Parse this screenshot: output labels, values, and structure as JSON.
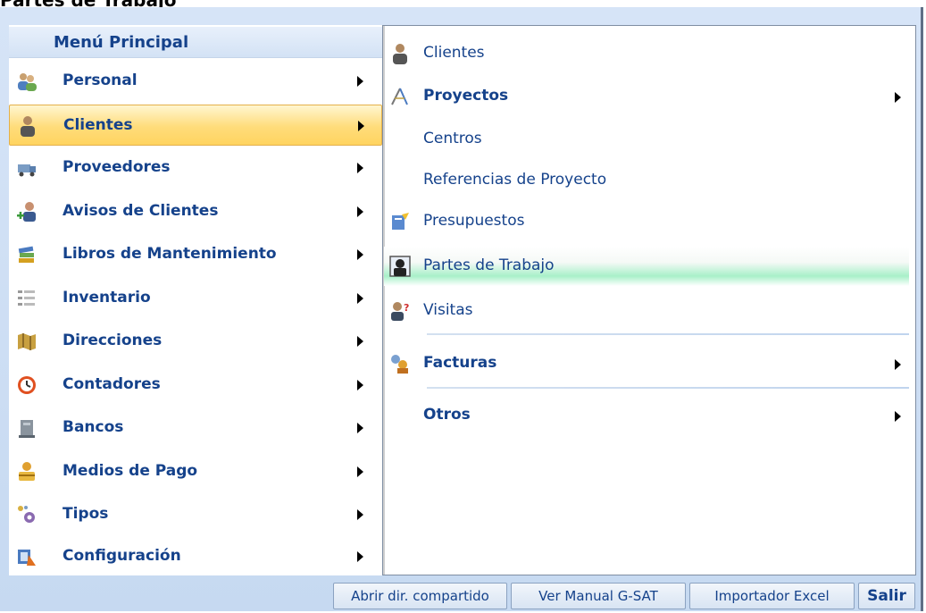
{
  "window": {
    "partial_title": "Partes de Trabajo"
  },
  "main_menu": {
    "header": "Menú Principal",
    "items": [
      {
        "label": "Personal",
        "icon": "people-icon"
      },
      {
        "label": "Clientes",
        "icon": "client-icon",
        "selected": true
      },
      {
        "label": "Proveedores",
        "icon": "truck-icon"
      },
      {
        "label": "Avisos de Clientes",
        "icon": "add-person-icon"
      },
      {
        "label": "Libros de Mantenimiento",
        "icon": "books-icon"
      },
      {
        "label": "Inventario",
        "icon": "list-icon"
      },
      {
        "label": "Direcciones",
        "icon": "map-icon"
      },
      {
        "label": "Contadores",
        "icon": "clock-icon"
      },
      {
        "label": "Bancos",
        "icon": "bank-icon"
      },
      {
        "label": "Medios de Pago",
        "icon": "payment-icon"
      },
      {
        "label": "Tipos",
        "icon": "types-icon"
      },
      {
        "label": "Configuración",
        "icon": "config-icon"
      }
    ]
  },
  "submenu": {
    "items": [
      {
        "label": "Clientes",
        "icon": "client-icon",
        "bold": false,
        "has_arrow": false
      },
      {
        "label": "Proyectos",
        "icon": "compass-icon",
        "bold": true,
        "has_arrow": true
      },
      {
        "label": "Centros",
        "icon": "",
        "bold": false,
        "has_arrow": false
      },
      {
        "label": "Referencias de Proyecto",
        "icon": "",
        "bold": false,
        "has_arrow": false
      },
      {
        "label": "Presupuestos",
        "icon": "budget-icon",
        "bold": false,
        "has_arrow": false
      },
      {
        "label": "Partes de Trabajo",
        "icon": "worker-icon",
        "bold": false,
        "has_arrow": false,
        "hover": true
      },
      {
        "label": "Visitas",
        "icon": "visit-icon",
        "bold": false,
        "has_arrow": false
      },
      {
        "label": "Facturas",
        "icon": "invoice-icon",
        "bold": true,
        "has_arrow": true
      },
      {
        "label": "Otros",
        "icon": "",
        "bold": true,
        "has_arrow": true
      }
    ]
  },
  "footer": {
    "open_shared_dir": "Abrir dir. compartido",
    "manual": "Ver Manual G-SAT",
    "importer": "Importador Excel",
    "exit": "Salir"
  },
  "colors": {
    "menu_text": "#15428b",
    "selected_bg": "#ffd460",
    "frame_bg": "#c6d9f1"
  }
}
